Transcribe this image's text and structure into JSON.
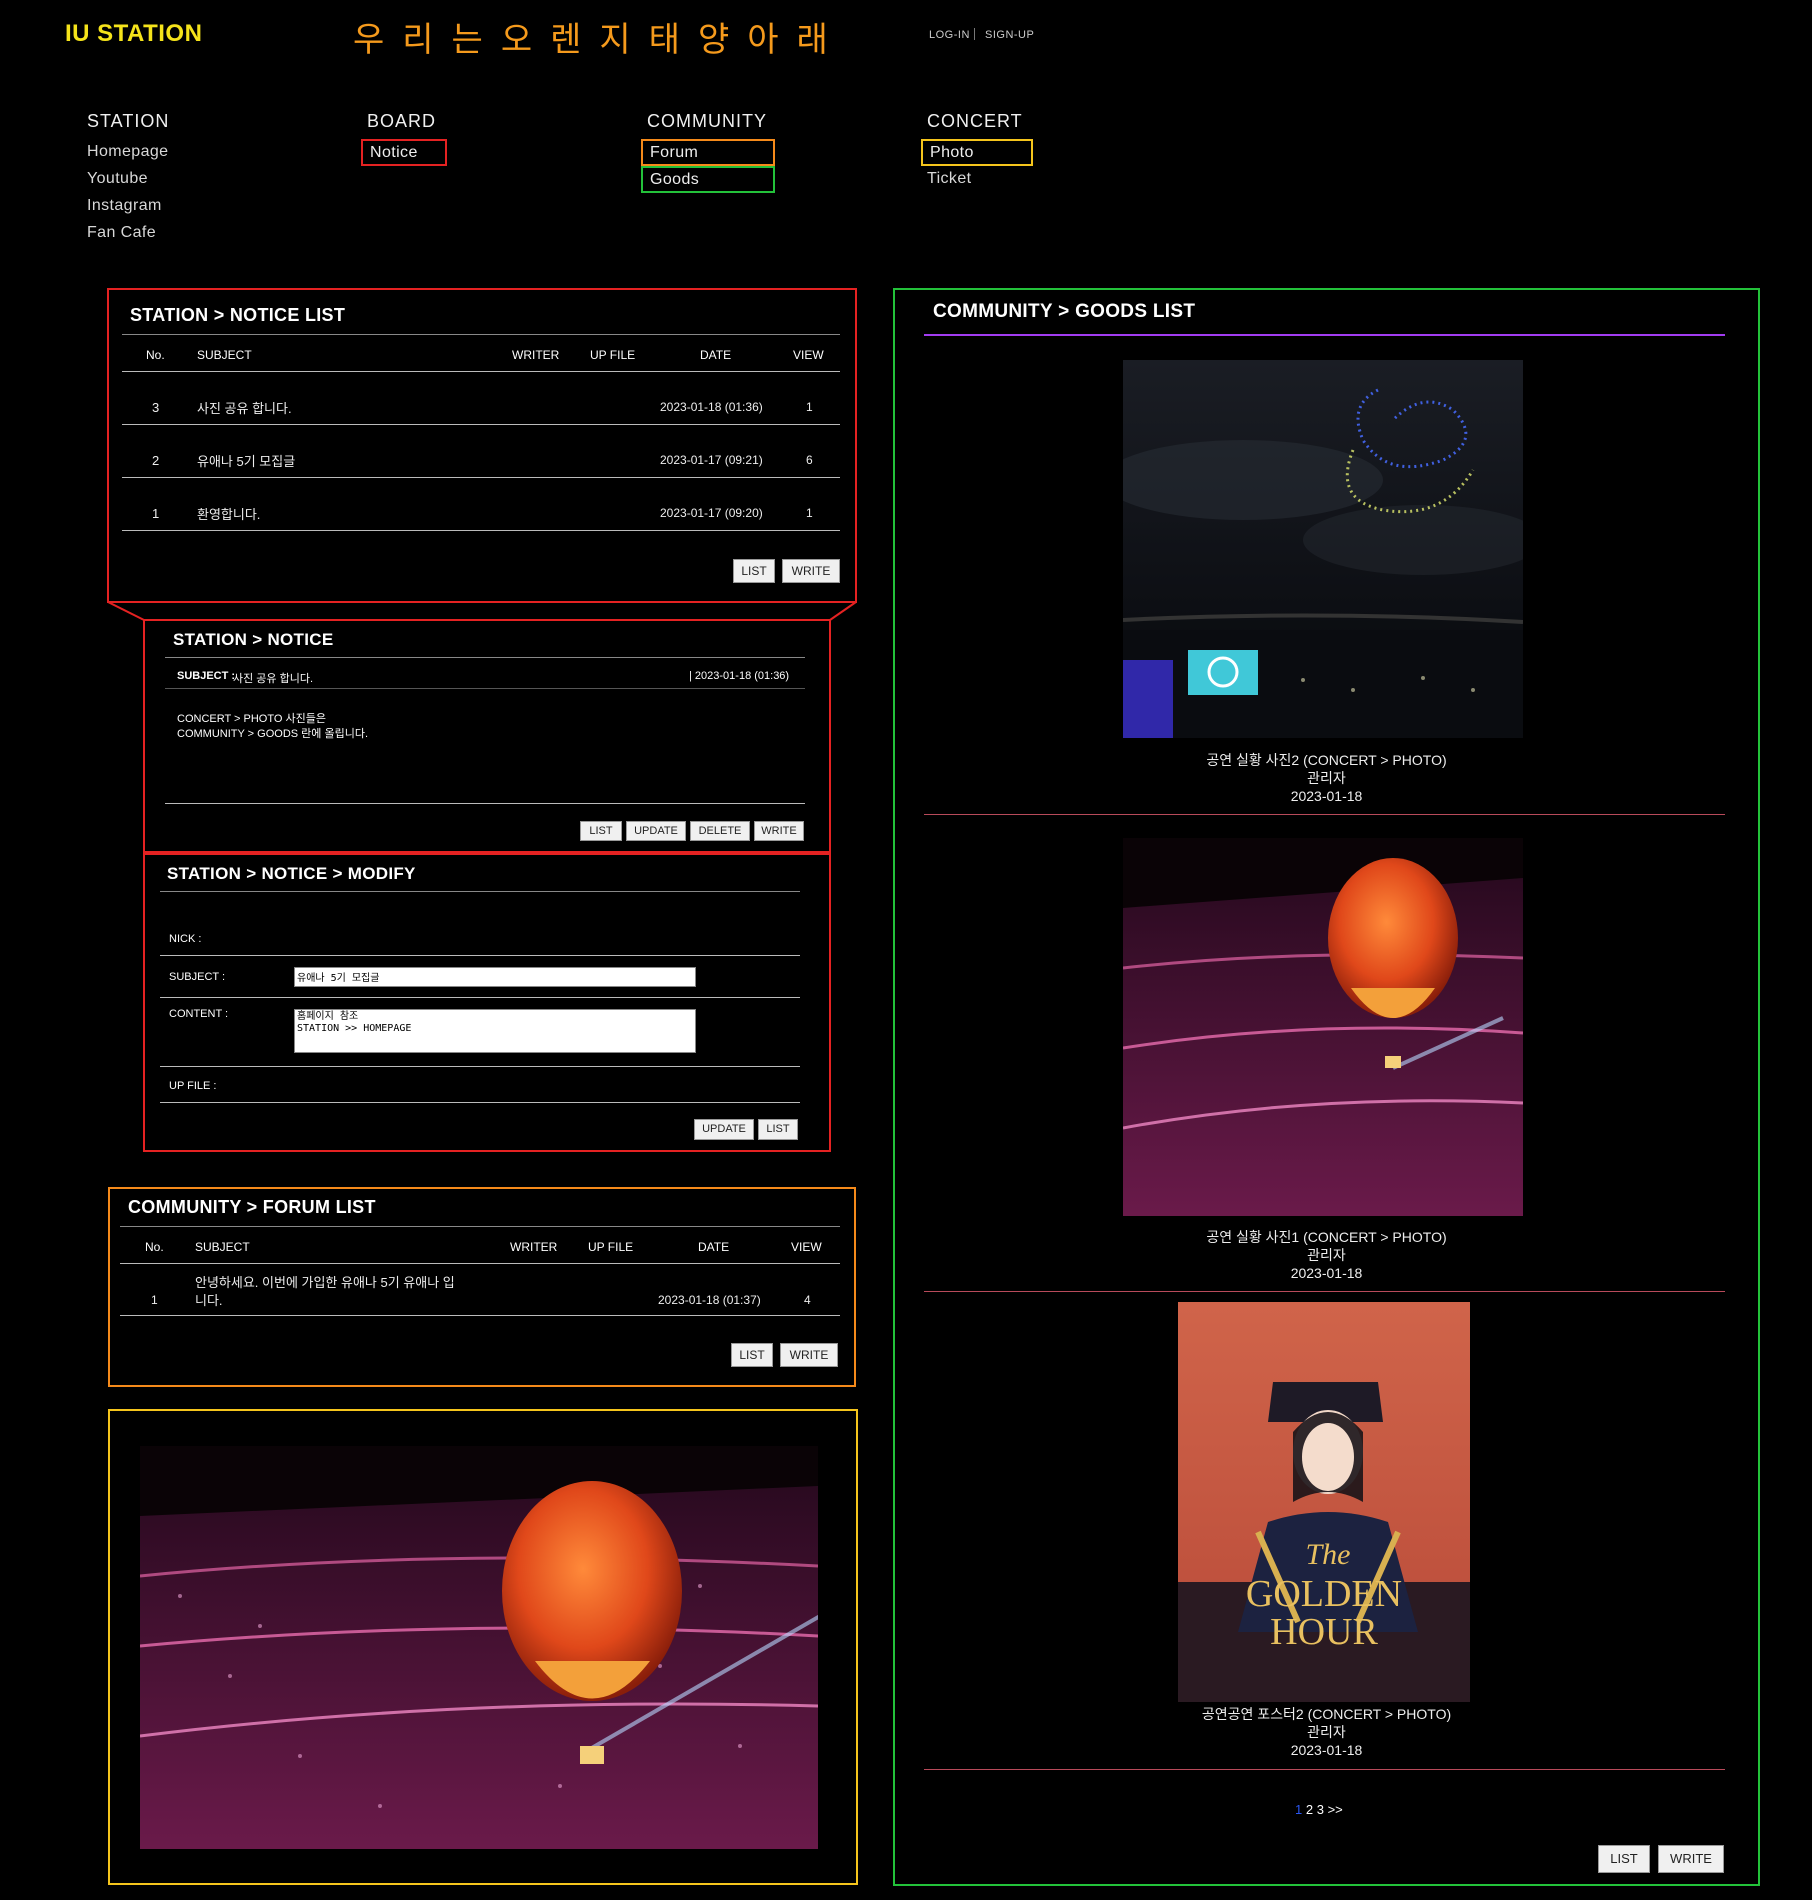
{
  "header": {
    "logo": "IU STATION",
    "slogan": "우리는오렌지태양아래",
    "login": "LOG-IN",
    "signup": "SIGN-UP"
  },
  "nav": {
    "station": {
      "label": "STATION",
      "items": [
        "Homepage",
        "Youtube",
        "Instagram",
        "Fan Cafe"
      ]
    },
    "board": {
      "label": "BOARD",
      "items": [
        "Notice"
      ]
    },
    "community": {
      "label": "COMMUNITY",
      "items": [
        "Forum",
        "Goods"
      ]
    },
    "concert": {
      "label": "CONCERT",
      "items": [
        "Photo",
        "Ticket"
      ]
    }
  },
  "notice_list": {
    "title": "STATION > NOTICE LIST",
    "columns": [
      "No.",
      "SUBJECT",
      "WRITER",
      "UP FILE",
      "DATE",
      "VIEW"
    ],
    "rows": [
      {
        "no": "3",
        "subject": "사진 공유 합니다.",
        "writer": "",
        "file": "",
        "date": "2023-01-18 (01:36)",
        "view": "1"
      },
      {
        "no": "2",
        "subject": "유애나 5기 모집글",
        "writer": "",
        "file": "",
        "date": "2023-01-17 (09:21)",
        "view": "6"
      },
      {
        "no": "1",
        "subject": "환영합니다.",
        "writer": "",
        "file": "",
        "date": "2023-01-17 (09:20)",
        "view": "1"
      }
    ],
    "buttons": {
      "list": "LIST",
      "write": "WRITE"
    }
  },
  "notice_view": {
    "title": "STATION > NOTICE",
    "subject_label": "SUBJECT :",
    "subject": "사진 공유 합니다.",
    "date": "| 2023-01-18 (01:36)",
    "body_line1": "CONCERT > PHOTO 사진들은",
    "body_line2": "COMMUNITY > GOODS 란에 올립니다.",
    "buttons": {
      "list": "LIST",
      "update": "UPDATE",
      "delete": "DELETE",
      "write": "WRITE"
    }
  },
  "notice_modify": {
    "title": "STATION > NOTICE > MODIFY",
    "nick_label": "NICK :",
    "subject_label": "SUBJECT :",
    "subject_value": "유애나 5기 모집글",
    "content_label": "CONTENT :",
    "content_value": "홈페이지 참조\nSTATION >> HOMEPAGE",
    "file_label": "UP FILE :",
    "buttons": {
      "update": "UPDATE",
      "list": "LIST"
    }
  },
  "forum_list": {
    "title": "COMMUNITY > FORUM LIST",
    "columns": [
      "No.",
      "SUBJECT",
      "WRITER",
      "UP FILE",
      "DATE",
      "VIEW"
    ],
    "rows": [
      {
        "no": "1",
        "subject_line1": "안녕하세요. 이번에 가입한 유애나 5기 유애나 입",
        "subject_line2": "니다.",
        "date": "2023-01-18 (01:37)",
        "view": "4"
      }
    ],
    "buttons": {
      "list": "LIST",
      "write": "WRITE"
    }
  },
  "goods_list": {
    "title": "COMMUNITY > GOODS LIST",
    "items": [
      {
        "title": "공연 실황 사진2 (CONCERT > PHOTO)",
        "writer": "관리자",
        "date": "2023-01-18",
        "image": "drone-show-photo"
      },
      {
        "title": "공연 실황 사진1 (CONCERT > PHOTO)",
        "writer": "관리자",
        "date": "2023-01-18",
        "image": "balloon-stadium-photo"
      },
      {
        "title": "공연공연 포스터2 (CONCERT > PHOTO)",
        "writer": "관리자",
        "date": "2023-01-18",
        "image": "golden-hour-poster"
      }
    ],
    "poster_text": {
      "line1": "The",
      "line2": "GOLDEN",
      "line3": "HOUR"
    },
    "pagination": {
      "current": "1",
      "pages": [
        "2",
        "3"
      ],
      "next": ">>"
    },
    "buttons": {
      "list": "LIST",
      "write": "WRITE"
    }
  },
  "colors": {
    "red": "#e52222",
    "orange": "#f58a1a",
    "yellow": "#f5c51c",
    "green": "#23c23a",
    "purple": "#a23cf0"
  }
}
